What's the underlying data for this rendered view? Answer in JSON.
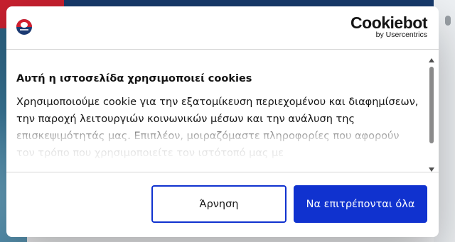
{
  "dialog": {
    "branding": {
      "site_logo_icon": "football-club-crest-icon",
      "cookiebot_wordmark": "Cookiebot",
      "cookiebot_byline": "by Usercentrics"
    },
    "title": "Αυτή η ιστοσελίδα χρησιμοποιεί cookies",
    "description": "Χρησιμοποιούμε cookie για την εξατομίκευση περιεχομένου και διαφημίσεων, την παροχή λειτουργιών κοινωνικών μέσων και την ανάλυση της επισκεψιμότητάς μας. Επιπλέον, μοιραζόμαστε πληροφορίες που αφορούν τον τρόπο που χρησιμοποιείτε τον ιστότοπό μας με",
    "buttons": {
      "deny": "Άρνηση",
      "allow_all": "Να επιτρέπονται όλα"
    }
  },
  "colors": {
    "primary_button": "#1032cf",
    "text": "#141414"
  }
}
